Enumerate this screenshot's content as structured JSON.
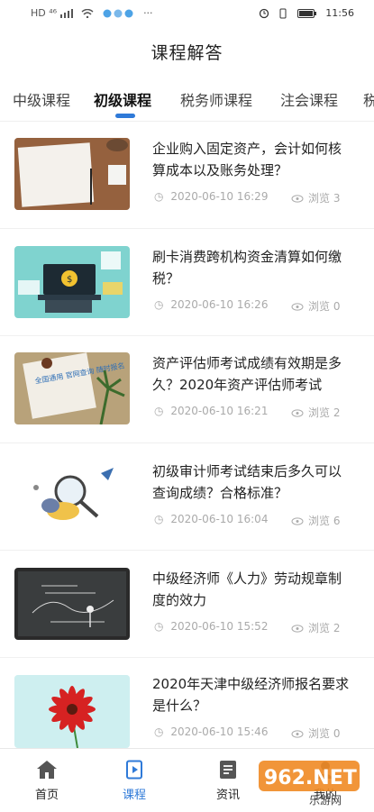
{
  "status_bar": {
    "time": "11:56",
    "signal_left": "HD ⁴⁶",
    "more": "···"
  },
  "header": {
    "title": "课程解答"
  },
  "tabs": [
    {
      "label": "中级课程",
      "active": false
    },
    {
      "label": "初级课程",
      "active": true
    },
    {
      "label": "税务师课程",
      "active": false
    },
    {
      "label": "注会课程",
      "active": false
    },
    {
      "label": "税",
      "active": false
    }
  ],
  "articles": [
    {
      "title": "企业购入固定资产，会计如何核算成本以及账务处理？",
      "time": "2020-06-10 16:29",
      "views": "浏览 3",
      "thumb": "notebook-on-desk"
    },
    {
      "title": "刷卡消费跨机构资金清算如何缴税？",
      "time": "2020-06-10 16:26",
      "views": "浏览 0",
      "thumb": "laptop-finance"
    },
    {
      "title": "资产评估师考试成绩有效期是多久？2020年资产评估师考试",
      "time": "2020-06-10 16:21",
      "views": "浏览 2",
      "thumb": "note-with-plant",
      "thumb_text": "全国通用 官网查询 随时报名"
    },
    {
      "title": "初级审计师考试结束后多久可以查询成绩？合格标准？",
      "time": "2020-06-10 16:04",
      "views": "浏览 6",
      "thumb": "magnifier-cartoon"
    },
    {
      "title": "中级经济师《人力》劳动规章制度的效力",
      "time": "2020-06-10 15:52",
      "views": "浏览 2",
      "thumb": "chalkboard"
    },
    {
      "title": "2020年天津中级经济师报名要求是什么？",
      "time": "2020-06-10 15:46",
      "views": "浏览 0",
      "thumb": "red-flower"
    }
  ],
  "bottom_nav": [
    {
      "label": "首页",
      "icon": "home-icon",
      "active": false
    },
    {
      "label": "课程",
      "icon": "course-icon",
      "active": true
    },
    {
      "label": "资讯",
      "icon": "news-icon",
      "active": false
    },
    {
      "label": "我的",
      "icon": "profile-icon",
      "active": false
    }
  ],
  "watermark": {
    "text": "962.NET",
    "subtext": "乐游网"
  },
  "colors": {
    "accent": "#2f7ad8",
    "meta": "#aaaaaa"
  }
}
